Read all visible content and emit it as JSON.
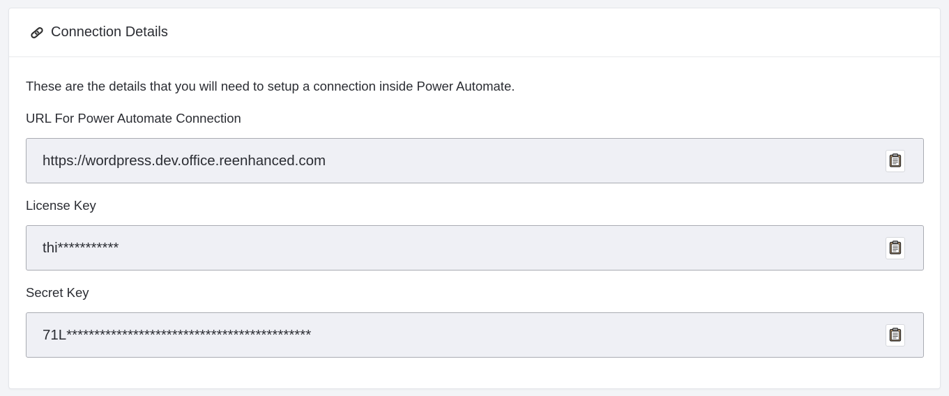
{
  "header": {
    "title": "Connection Details",
    "icon": "link-icon"
  },
  "intro": "These are the details that you will need to setup a connection inside Power Automate.",
  "fields": [
    {
      "label": "URL For Power Automate Connection",
      "value": "https://wordpress.dev.office.reenhanced.com",
      "copy_icon": "clipboard-icon"
    },
    {
      "label": "License Key",
      "value": "thi***********",
      "copy_icon": "clipboard-icon"
    },
    {
      "label": "Secret Key",
      "value": "71L********************************************",
      "copy_icon": "clipboard-icon"
    }
  ],
  "colors": {
    "page_bg": "#f3f4f7",
    "card_bg": "#ffffff",
    "field_bg": "#eff0f5",
    "field_border": "#a9abb2",
    "text": "#2b2d33",
    "clipboard_fill": "#c9a57a"
  }
}
